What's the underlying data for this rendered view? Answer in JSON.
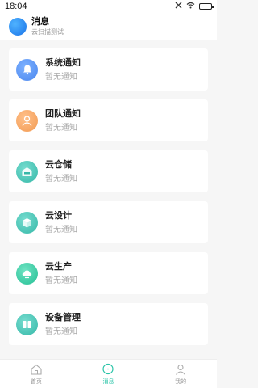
{
  "status_bar": {
    "time": "18:04"
  },
  "header": {
    "title": "消息",
    "subtitle": "云扫描测试"
  },
  "notifications": [
    {
      "title": "系统通知",
      "subtitle": "暂无通知",
      "icon": "bell-icon",
      "color": "#4a8ff0"
    },
    {
      "title": "团队通知",
      "subtitle": "暂无通知",
      "icon": "team-icon",
      "color": "#f5a25c"
    },
    {
      "title": "云仓储",
      "subtitle": "暂无通知",
      "icon": "warehouse-icon",
      "color": "#3fc3b5"
    },
    {
      "title": "云设计",
      "subtitle": "暂无通知",
      "icon": "design-icon",
      "color": "#3fc3b5"
    },
    {
      "title": "云生产",
      "subtitle": "暂无通知",
      "icon": "production-icon",
      "color": "#2ec9a0"
    },
    {
      "title": "设备管理",
      "subtitle": "暂无通知",
      "icon": "device-icon",
      "color": "#3fc3b5"
    }
  ],
  "tabbar": {
    "items": [
      {
        "label": "首页",
        "icon": "home-icon",
        "active": false
      },
      {
        "label": "消息",
        "icon": "message-icon",
        "active": true
      },
      {
        "label": "我的",
        "icon": "profile-icon",
        "active": false
      }
    ]
  },
  "colors": {
    "accent": "#2bc4a8",
    "background": "#f6f6f6"
  }
}
